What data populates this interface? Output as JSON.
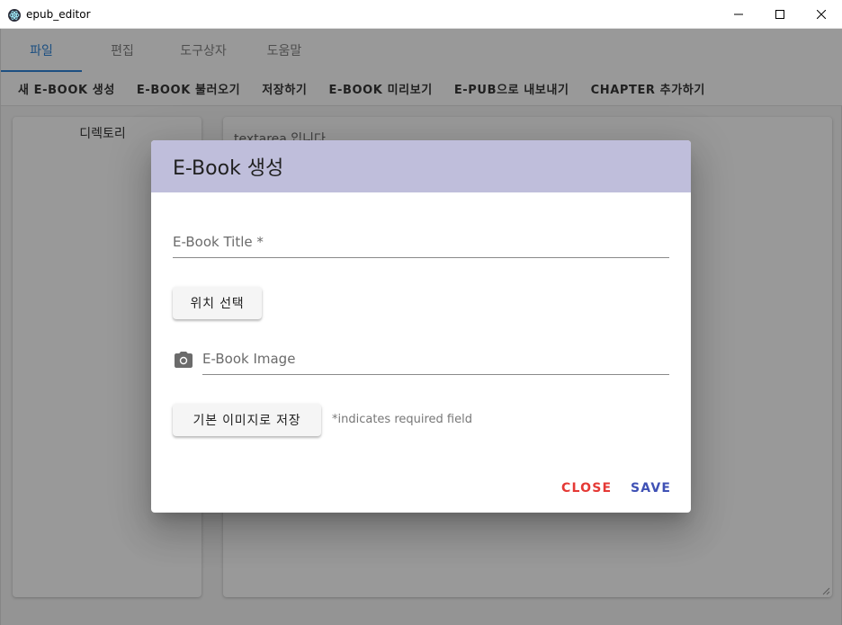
{
  "window": {
    "title": "epub_editor",
    "controls": [
      "minimize-icon",
      "maximize-icon",
      "close-icon"
    ]
  },
  "tabs": [
    {
      "label": "파일",
      "active": true
    },
    {
      "label": "편집",
      "active": false
    },
    {
      "label": "도구상자",
      "active": false
    },
    {
      "label": "도움말",
      "active": false
    }
  ],
  "toolbar": {
    "items": [
      "새 E-BOOK 생성",
      "E-BOOK 불러오기",
      "저장하기",
      "E-BOOK 미리보기",
      "E-PUB으로 내보내기",
      "CHAPTER 추가하기"
    ]
  },
  "sidebar": {
    "title": "디렉토리"
  },
  "editor": {
    "placeholder_text": "textarea 입니다"
  },
  "dialog": {
    "title": "E-Book 생성",
    "title_field_label": "E-Book Title *",
    "location_button": "위치 선택",
    "image_field_label": "E-Book Image",
    "image_icon": "camera-icon",
    "default_image_button": "기본 이미지로 저장",
    "required_hint": "*indicates required field",
    "close_label": "CLOSE",
    "save_label": "SAVE"
  },
  "colors": {
    "accent": "#1976d2",
    "dialog_header": "#bfbedb",
    "close": "#e53935",
    "save": "#3f51b5"
  }
}
